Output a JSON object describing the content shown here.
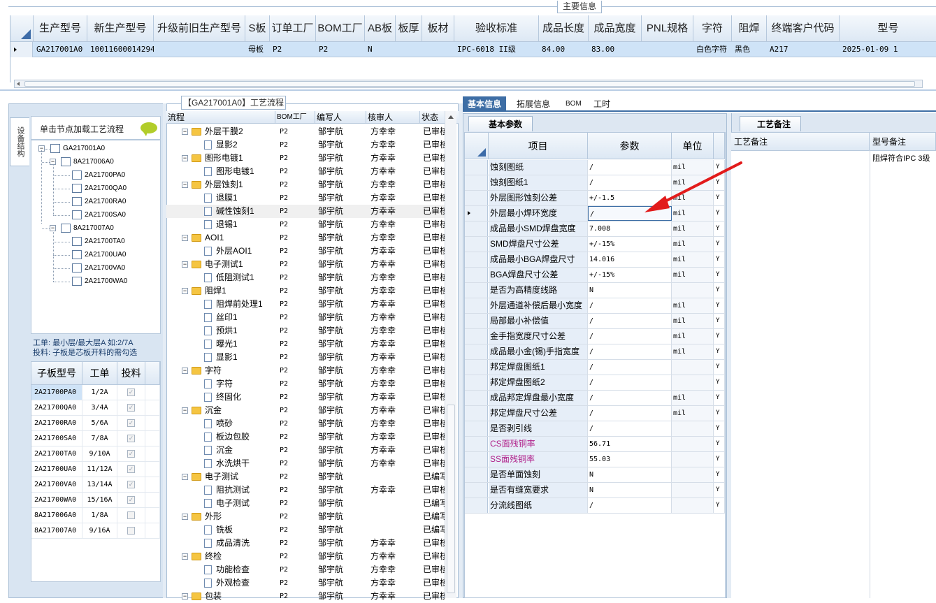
{
  "main_info": {
    "title": "主要信息",
    "columns": [
      "生产型号",
      "新生产型号",
      "升级前旧生产型号",
      "S板",
      "订单工厂",
      "BOM工厂",
      "AB板",
      "板厚",
      "板材",
      "验收标准",
      "成品长度",
      "成品宽度",
      "PNL规格",
      "字符",
      "阻焊",
      "终端客户代码",
      "型号"
    ],
    "row": [
      "GA217001A0",
      "10011600014294",
      "",
      "母板",
      "P2",
      "P2",
      "N",
      "",
      "",
      "IPC-6018 II级",
      "84.00",
      "83.00",
      "",
      "白色字符",
      "黑色",
      "A217",
      "2025-01-09 1"
    ]
  },
  "left": {
    "vertical_tab": "设备结构",
    "header": "单击节点加载工艺流程",
    "tree": {
      "root": "GA217001A0",
      "groups": [
        {
          "label": "8A217006A0",
          "children": [
            "2A21700PA0",
            "2A21700QA0",
            "2A21700RA0",
            "2A21700SA0"
          ]
        },
        {
          "label": "8A217007A0",
          "children": [
            "2A21700TA0",
            "2A21700UA0",
            "2A21700VA0",
            "2A21700WA0"
          ]
        }
      ]
    },
    "info_line1": "工单: 最小层/最大层A 如:2/7A",
    "info_line2": "投料: 子板是芯板开料的需勾选",
    "sub_grid": {
      "headers": [
        "子板型号",
        "工单",
        "投料"
      ],
      "rows": [
        {
          "model": "2A21700PA0",
          "order": "1/2A",
          "checked": true
        },
        {
          "model": "2A21700QA0",
          "order": "3/4A",
          "checked": true
        },
        {
          "model": "2A21700RA0",
          "order": "5/6A",
          "checked": true
        },
        {
          "model": "2A21700SA0",
          "order": "7/8A",
          "checked": true
        },
        {
          "model": "2A21700TA0",
          "order": "9/10A",
          "checked": true
        },
        {
          "model": "2A21700UA0",
          "order": "11/12A",
          "checked": true
        },
        {
          "model": "2A21700VA0",
          "order": "13/14A",
          "checked": true
        },
        {
          "model": "2A21700WA0",
          "order": "15/16A",
          "checked": true
        },
        {
          "model": "8A217006A0",
          "order": "1/8A",
          "checked": false
        },
        {
          "model": "8A217007A0",
          "order": "9/16A",
          "checked": false
        }
      ]
    }
  },
  "flow": {
    "title": "【GA217001A0】工艺流程",
    "headers": [
      "流程",
      "BOM工厂",
      "编写人",
      "核审人",
      "状态"
    ],
    "rows": [
      {
        "name": "外层干膜2",
        "type": "folder",
        "factory": "P2",
        "writer": "邹宇航",
        "reviewer": "方幸幸",
        "status": "已审核"
      },
      {
        "name": "显影2",
        "type": "doc",
        "factory": "P2",
        "writer": "邹宇航",
        "reviewer": "方幸幸",
        "status": "已审核"
      },
      {
        "name": "图形电镀1",
        "type": "folder",
        "factory": "P2",
        "writer": "邹宇航",
        "reviewer": "方幸幸",
        "status": "已审核"
      },
      {
        "name": "图形电镀1",
        "type": "doc",
        "factory": "P2",
        "writer": "邹宇航",
        "reviewer": "方幸幸",
        "status": "已审核"
      },
      {
        "name": "外层蚀刻1",
        "type": "folder",
        "factory": "P2",
        "writer": "邹宇航",
        "reviewer": "方幸幸",
        "status": "已审核"
      },
      {
        "name": "退膜1",
        "type": "doc",
        "factory": "P2",
        "writer": "邹宇航",
        "reviewer": "方幸幸",
        "status": "已审核"
      },
      {
        "name": "碱性蚀刻1",
        "type": "doc",
        "factory": "P2",
        "writer": "邹宇航",
        "reviewer": "方幸幸",
        "status": "已审核",
        "selected": true
      },
      {
        "name": "退锡1",
        "type": "doc",
        "factory": "P2",
        "writer": "邹宇航",
        "reviewer": "方幸幸",
        "status": "已审核"
      },
      {
        "name": "AOI1",
        "type": "folder",
        "factory": "P2",
        "writer": "邹宇航",
        "reviewer": "方幸幸",
        "status": "已审核"
      },
      {
        "name": "外层AOI1",
        "type": "doc",
        "factory": "P2",
        "writer": "邹宇航",
        "reviewer": "方幸幸",
        "status": "已审核"
      },
      {
        "name": "电子测试1",
        "type": "folder",
        "factory": "P2",
        "writer": "邹宇航",
        "reviewer": "方幸幸",
        "status": "已审核"
      },
      {
        "name": "低阻测试1",
        "type": "doc",
        "factory": "P2",
        "writer": "邹宇航",
        "reviewer": "方幸幸",
        "status": "已审核"
      },
      {
        "name": "阻焊1",
        "type": "folder",
        "factory": "P2",
        "writer": "邹宇航",
        "reviewer": "方幸幸",
        "status": "已审核"
      },
      {
        "name": "阻焊前处理1",
        "type": "doc",
        "factory": "P2",
        "writer": "邹宇航",
        "reviewer": "方幸幸",
        "status": "已审核"
      },
      {
        "name": "丝印1",
        "type": "doc",
        "factory": "P2",
        "writer": "邹宇航",
        "reviewer": "方幸幸",
        "status": "已审核"
      },
      {
        "name": "预烘1",
        "type": "doc",
        "factory": "P2",
        "writer": "邹宇航",
        "reviewer": "方幸幸",
        "status": "已审核"
      },
      {
        "name": "曝光1",
        "type": "doc",
        "factory": "P2",
        "writer": "邹宇航",
        "reviewer": "方幸幸",
        "status": "已审核"
      },
      {
        "name": "显影1",
        "type": "doc",
        "factory": "P2",
        "writer": "邹宇航",
        "reviewer": "方幸幸",
        "status": "已审核"
      },
      {
        "name": "字符",
        "type": "folder",
        "factory": "P2",
        "writer": "邹宇航",
        "reviewer": "方幸幸",
        "status": "已审核"
      },
      {
        "name": "字符",
        "type": "doc",
        "factory": "P2",
        "writer": "邹宇航",
        "reviewer": "方幸幸",
        "status": "已审核"
      },
      {
        "name": "终固化",
        "type": "doc",
        "factory": "P2",
        "writer": "邹宇航",
        "reviewer": "方幸幸",
        "status": "已审核"
      },
      {
        "name": "沉金",
        "type": "folder",
        "factory": "P2",
        "writer": "邹宇航",
        "reviewer": "方幸幸",
        "status": "已审核"
      },
      {
        "name": "喷砂",
        "type": "doc",
        "factory": "P2",
        "writer": "邹宇航",
        "reviewer": "方幸幸",
        "status": "已审核"
      },
      {
        "name": "板边包胶",
        "type": "doc",
        "factory": "P2",
        "writer": "邹宇航",
        "reviewer": "方幸幸",
        "status": "已审核"
      },
      {
        "name": "沉金",
        "type": "doc",
        "factory": "P2",
        "writer": "邹宇航",
        "reviewer": "方幸幸",
        "status": "已审核"
      },
      {
        "name": "水洗烘干",
        "type": "doc",
        "factory": "P2",
        "writer": "邹宇航",
        "reviewer": "方幸幸",
        "status": "已审核"
      },
      {
        "name": "电子测试",
        "type": "folder",
        "factory": "P2",
        "writer": "邹宇航",
        "reviewer": "",
        "status": "已编写"
      },
      {
        "name": "阻抗测试",
        "type": "doc",
        "factory": "P2",
        "writer": "邹宇航",
        "reviewer": "方幸幸",
        "status": "已审核"
      },
      {
        "name": "电子测试",
        "type": "doc",
        "factory": "P2",
        "writer": "邹宇航",
        "reviewer": "",
        "status": "已编写"
      },
      {
        "name": "外形",
        "type": "folder",
        "factory": "P2",
        "writer": "邹宇航",
        "reviewer": "",
        "status": "已编写"
      },
      {
        "name": "铣板",
        "type": "doc",
        "factory": "P2",
        "writer": "邹宇航",
        "reviewer": "",
        "status": "已编写"
      },
      {
        "name": "成品清洗",
        "type": "doc",
        "factory": "P2",
        "writer": "邹宇航",
        "reviewer": "方幸幸",
        "status": "已审核"
      },
      {
        "name": "终检",
        "type": "folder",
        "factory": "P2",
        "writer": "邹宇航",
        "reviewer": "方幸幸",
        "status": "已审核"
      },
      {
        "name": "功能检查",
        "type": "doc",
        "factory": "P2",
        "writer": "邹宇航",
        "reviewer": "方幸幸",
        "status": "已审核"
      },
      {
        "name": "外观检查",
        "type": "doc",
        "factory": "P2",
        "writer": "邹宇航",
        "reviewer": "方幸幸",
        "status": "已审核"
      },
      {
        "name": "包装",
        "type": "folder",
        "factory": "P2",
        "writer": "邹宇航",
        "reviewer": "方幸幸",
        "status": "已审核"
      }
    ]
  },
  "tabs": [
    "基本信息",
    "拓展信息",
    "BOM",
    "工时"
  ],
  "basic": {
    "tab": "基本参数",
    "headers": [
      "项目",
      "参数",
      "单位"
    ],
    "rows": [
      {
        "item": "蚀刻图纸",
        "param": "/",
        "unit": "mil",
        "flag": "Y"
      },
      {
        "item": "蚀刻图纸1",
        "param": "/",
        "unit": "mil",
        "flag": "Y"
      },
      {
        "item": "外层图形蚀刻公差",
        "param": "+/-1.5",
        "unit": "mil",
        "flag": "Y"
      },
      {
        "item": "外层最小焊环宽度",
        "param": "/",
        "unit": "mil",
        "flag": "Y",
        "current": true
      },
      {
        "item": "成品最小SMD焊盘宽度",
        "param": "7.008",
        "unit": "mil",
        "flag": "Y"
      },
      {
        "item": "SMD焊盘尺寸公差",
        "param": "+/-15%",
        "unit": "mil",
        "flag": "Y"
      },
      {
        "item": "成品最小BGA焊盘尺寸",
        "param": "14.016",
        "unit": "mil",
        "flag": "Y"
      },
      {
        "item": "BGA焊盘尺寸公差",
        "param": "+/-15%",
        "unit": "mil",
        "flag": "Y"
      },
      {
        "item": "是否为高精度线路",
        "param": "N",
        "unit": "",
        "flag": "Y"
      },
      {
        "item": "外层通道补偿后最小宽度",
        "param": "/",
        "unit": "mil",
        "flag": "Y"
      },
      {
        "item": "局部最小补偿值",
        "param": "/",
        "unit": "mil",
        "flag": "Y"
      },
      {
        "item": "金手指宽度尺寸公差",
        "param": "/",
        "unit": "mil",
        "flag": "Y"
      },
      {
        "item": "成品最小金(锡)手指宽度",
        "param": "/",
        "unit": "mil",
        "flag": "Y"
      },
      {
        "item": "邦定焊盘图纸1",
        "param": "/",
        "unit": "",
        "flag": "Y"
      },
      {
        "item": "邦定焊盘图纸2",
        "param": "/",
        "unit": "",
        "flag": "Y"
      },
      {
        "item": "成品邦定焊盘最小宽度",
        "param": "/",
        "unit": "mil",
        "flag": "Y"
      },
      {
        "item": "邦定焊盘尺寸公差",
        "param": "/",
        "unit": "mil",
        "flag": "Y"
      },
      {
        "item": "是否剥引线",
        "param": "/",
        "unit": "",
        "flag": "Y"
      },
      {
        "item": "CS面残铜率",
        "param": "56.71",
        "unit": "",
        "flag": "Y",
        "magenta": true
      },
      {
        "item": "SS面残铜率",
        "param": "55.03",
        "unit": "",
        "flag": "Y",
        "magenta": true
      },
      {
        "item": "是否单面蚀刻",
        "param": "N",
        "unit": "",
        "flag": "Y"
      },
      {
        "item": "是否有缝宽要求",
        "param": "N",
        "unit": "",
        "flag": "Y"
      },
      {
        "item": "分流线图纸",
        "param": "/",
        "unit": "",
        "flag": "Y"
      }
    ]
  },
  "notes": {
    "tab": "工艺备注",
    "col1": "工艺备注",
    "col2": "型号备注",
    "text": "阻焊符合IPC 3级"
  },
  "colors": {
    "accent": "#3e6ea5",
    "selected_row": "#cfe3f7",
    "arrow": "#e21b1b"
  }
}
